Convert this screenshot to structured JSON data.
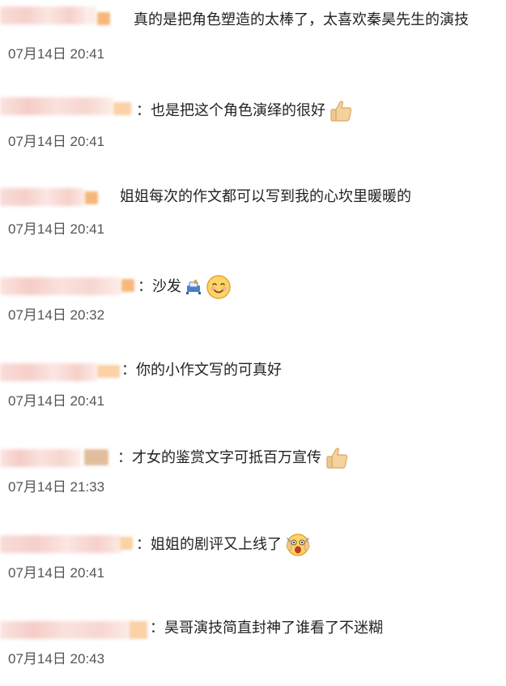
{
  "comments": [
    {
      "text": "真的是把角色塑造的太棒了，太喜欢秦昊先生的演技",
      "time": "07月14日 20:41"
    },
    {
      "colon": "：",
      "text": "也是把这个角色演绎的很好",
      "emoji": "thumbs-up-icon",
      "time": "07月14日 20:41"
    },
    {
      "text": "姐姐每次的作文都可以写到我的心坎里暖暖的",
      "time": "07月14日 20:41"
    },
    {
      "colon": "：",
      "text": "沙发",
      "emoji": "sofa-icon",
      "emoji2": "smiling-face-icon",
      "time": "07月14日 20:32"
    },
    {
      "colon": "：",
      "text": "你的小作文写的可真好",
      "time": "07月14日 20:41"
    },
    {
      "colon": "：",
      "text": "才女的鉴赏文字可抵百万宣传",
      "emoji": "thumbs-up-icon",
      "time": "07月14日 21:33"
    },
    {
      "colon": "：",
      "text": "姐姐的剧评又上线了",
      "emoji": "shocked-face-icon",
      "time": "07月14日 20:41"
    },
    {
      "colon": "：",
      "text": "昊哥演技简直封神了谁看了不迷糊",
      "time": "07月14日 20:43"
    }
  ],
  "colors": {
    "text": "#222222",
    "timestamp": "#555555",
    "blur_pink": "#f7cfca",
    "blur_orange": "#f7b77a"
  }
}
